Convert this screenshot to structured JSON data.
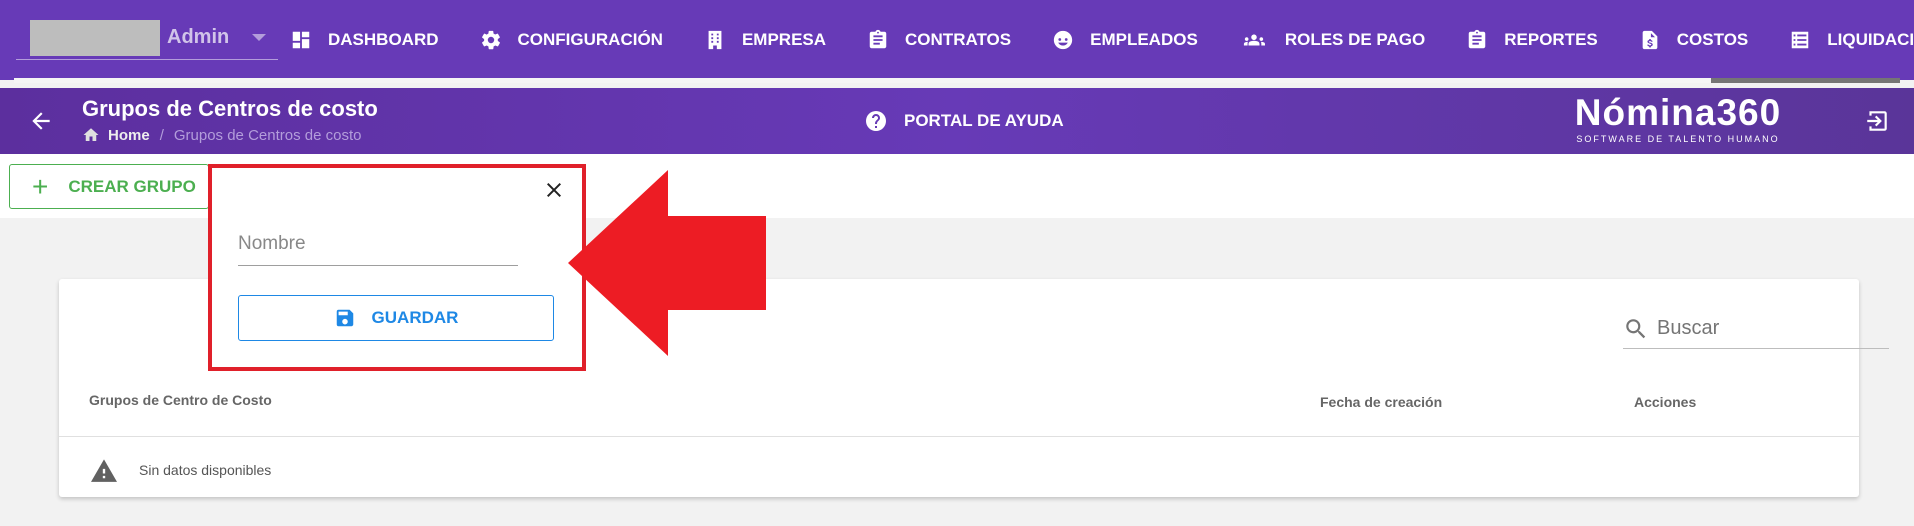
{
  "user": {
    "name": "Admin"
  },
  "nav": {
    "items": [
      {
        "label": "DASHBOARD",
        "icon": "dashboard-icon"
      },
      {
        "label": "CONFIGURACIÓN",
        "icon": "gear-icon"
      },
      {
        "label": "EMPRESA",
        "icon": "building-icon"
      },
      {
        "label": "CONTRATOS",
        "icon": "clipboard-icon"
      },
      {
        "label": "EMPLEADOS",
        "icon": "face-icon"
      },
      {
        "label": "ROLES DE PAGO",
        "icon": "users-icon"
      },
      {
        "label": "REPORTES",
        "icon": "clipboard-icon"
      },
      {
        "label": "COSTOS",
        "icon": "dollar-file-icon"
      },
      {
        "label": "LIQUIDACIONES",
        "icon": "list-icon"
      }
    ],
    "progress_fraction": 0.9
  },
  "header": {
    "title": "Grupos de Centros de costo",
    "breadcrumb": {
      "home": "Home",
      "separator": "/",
      "current": "Grupos de Centros de costo"
    },
    "help_label": "PORTAL DE AYUDA",
    "brand_name": "Nómina360",
    "brand_tagline": "SOFTWARE DE TALENTO HUMANO"
  },
  "toolbar": {
    "create_label": "CREAR GRUPO",
    "create_icon": "plus-icon"
  },
  "popup": {
    "name_placeholder": "Nombre",
    "name_value": "",
    "save_label": "GUARDAR",
    "save_icon": "floppy-disk-icon",
    "close_icon": "close-icon"
  },
  "table": {
    "search_placeholder": "Buscar",
    "columns": [
      "Grupos de Centro de Costo",
      "Fecha de creación",
      "Acciones"
    ],
    "empty_text": "Sin datos disponibles"
  },
  "colors": {
    "primary": "#673ab7",
    "create": "#4caf50",
    "save": "#1e88e5",
    "annotation": "#e0202a"
  }
}
